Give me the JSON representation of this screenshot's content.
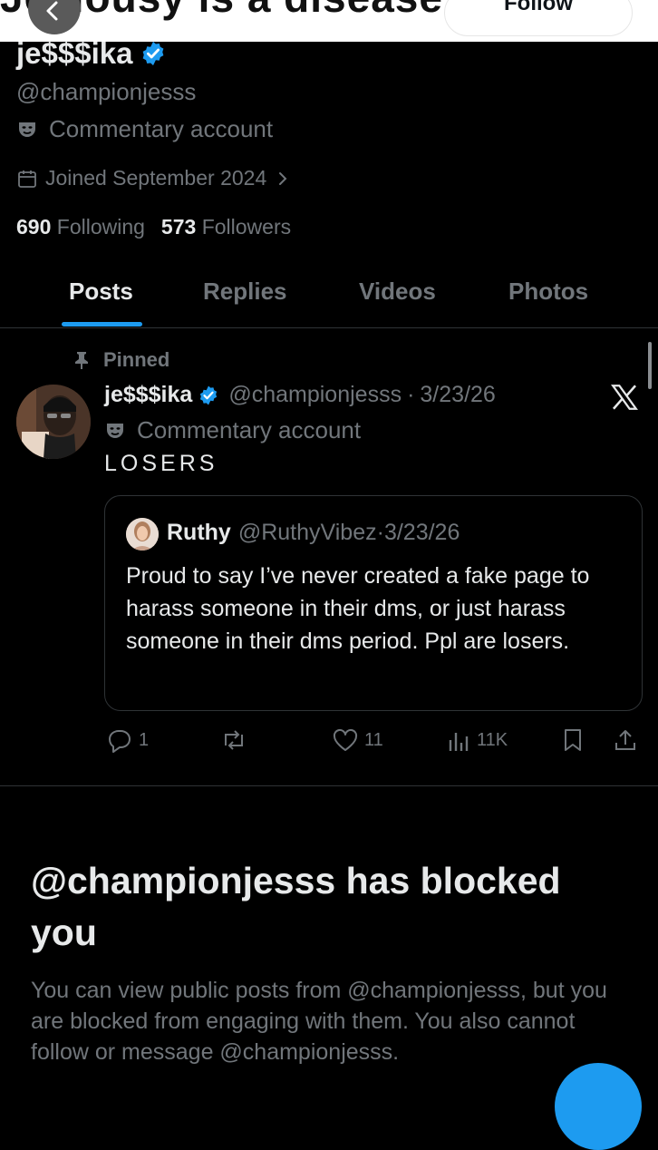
{
  "banner": {
    "text": "Jealousy is a disease. Die G",
    "follow_label": "Follow"
  },
  "profile": {
    "name": "je$$$ika",
    "handle": "@championjesss",
    "category": "Commentary account",
    "joined": "Joined September 2024",
    "following_count": "690",
    "following_label": "Following",
    "followers_count": "573",
    "followers_label": "Followers"
  },
  "tabs": [
    {
      "label": "Posts"
    },
    {
      "label": "Replies"
    },
    {
      "label": "Videos"
    },
    {
      "label": "Photos"
    }
  ],
  "active_tab": "Posts",
  "post": {
    "pinned_label": "Pinned",
    "author_name": "je$$$ika",
    "author_handle": "@championjesss",
    "dot": "·",
    "date": "3/23/26",
    "category": "Commentary account",
    "text": "LOSERS",
    "quote": {
      "author_name": "Ruthy",
      "author_handle": "@RuthyVibez",
      "dot": "·",
      "date": "3/23/26",
      "text": "Proud to say I’ve never created a fake page to harass someone in their dms, or just harass someone in their dms period. Ppl are losers."
    },
    "actions": {
      "replies": "1",
      "likes": "11",
      "views": "11K"
    }
  },
  "blocked": {
    "title": "@championjesss has blocked you",
    "description": "You can view public posts from @championjesss, but you are blocked from engaging with them. You also cannot follow or message @championjesss."
  },
  "colors": {
    "accent": "#1d9bf0",
    "muted": "#71767b",
    "text": "#e7e9ea",
    "background": "#000000"
  }
}
